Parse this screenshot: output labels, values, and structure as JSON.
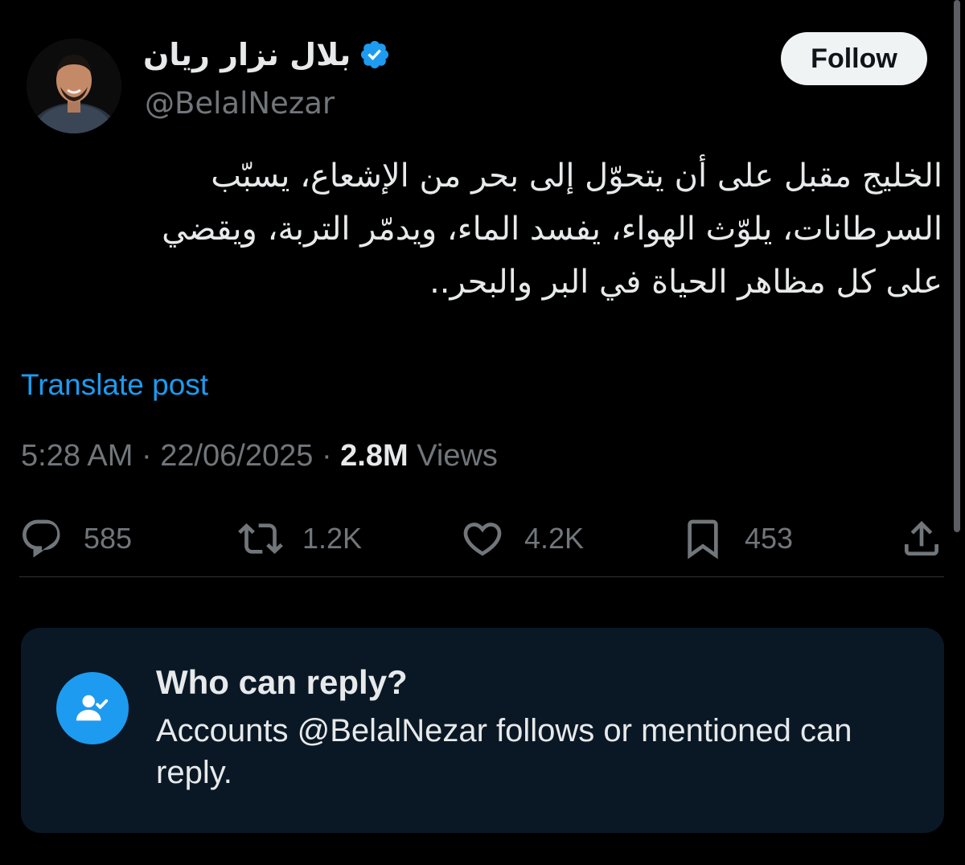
{
  "author": {
    "display_name": "بلال نزار ريان",
    "handle": "@BelalNezar",
    "verified_color": "#1d9bf0"
  },
  "follow_button": {
    "label": "Follow"
  },
  "tweet": {
    "lines": [
      "الخليج مقبل على أن يتحوّل إلى بحر من الإشعاع، يسبّب",
      "السرطانات، يلوّث الهواء، يفسد الماء، ويدمّر التربة، ويقضي",
      "على كل مظاهر الحياة في البر والبحر.."
    ]
  },
  "translate_link": "Translate post",
  "meta": {
    "time": "5:28 AM",
    "separator": " · ",
    "date": "22/06/2025",
    "views_count": "2.8M",
    "views_label": "Views"
  },
  "actions": {
    "replies": "585",
    "reposts": "1.2K",
    "likes": "4.2K",
    "bookmarks": "453"
  },
  "reply_restriction": {
    "title": "Who can reply?",
    "description": "Accounts @BelalNezar follows or mentioned can reply."
  },
  "colors": {
    "background": "#000000",
    "accent": "#1d9bf0",
    "muted": "#71767b",
    "card_background": "#0a1826"
  },
  "icons": [
    "verified-badge-icon",
    "reply-icon",
    "repost-icon",
    "like-icon",
    "bookmark-icon",
    "share-icon",
    "user-check-icon"
  ]
}
